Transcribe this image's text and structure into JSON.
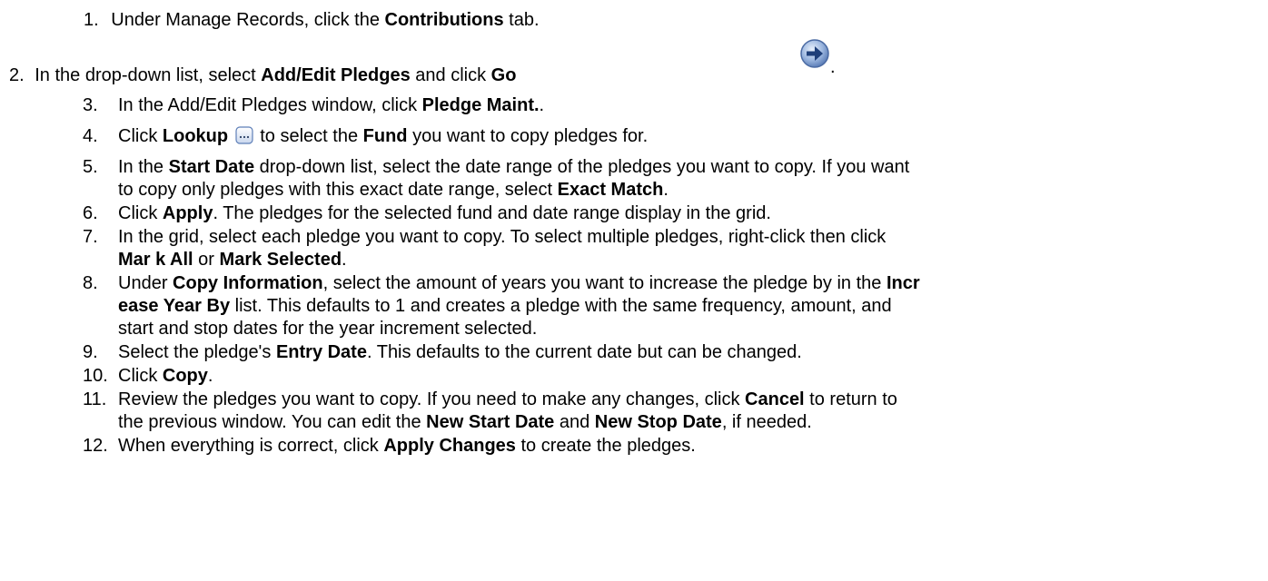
{
  "steps": [
    {
      "num": "1.",
      "parts": [
        "Under Manage Records, click the ",
        "Contributions",
        " tab."
      ]
    },
    {
      "num": "2.",
      "parts": [
        "In the drop-down list, select ",
        "Add/Edit Pledges",
        " and click ",
        "Go"
      ],
      "trailing": "."
    },
    {
      "num": "3.",
      "parts": [
        "In the Add/Edit Pledges window, click ",
        "Pledge Maint.",
        "."
      ]
    },
    {
      "num": "4.",
      "parts": [
        "Click ",
        "Lookup",
        " to select the ",
        "Fund",
        " you want to copy pledges for."
      ]
    },
    {
      "num": "5.",
      "lines": [
        [
          "In the ",
          "Start Date",
          " drop-down list, select the date range of the pledges you want to copy. If you want"
        ],
        [
          "to copy only pledges with this exact date range, select ",
          "Exact Match",
          "."
        ]
      ]
    },
    {
      "num": "6.",
      "parts": [
        "Click ",
        "Apply",
        ". The pledges for the selected fund and date range display in the grid."
      ]
    },
    {
      "num": "7.",
      "lines": [
        [
          "In the grid, select each pledge you want to copy. To select multiple pledges, right-click then click"
        ],
        [
          "",
          "Mar k All",
          " or ",
          "Mark Selected",
          "."
        ]
      ]
    },
    {
      "num": "8.",
      "lines": [
        [
          "Under ",
          "Copy Information",
          ", select the amount of years you want to increase the pledge by in the ",
          "Incr"
        ],
        [
          "",
          "ease Year By",
          " list. This defaults to 1 and creates a pledge with the same frequency, amount, and"
        ],
        [
          "start and stop dates for the year increment selected."
        ]
      ]
    },
    {
      "num": "9.",
      "parts": [
        "Select the pledge's ",
        "Entry Date",
        ". This defaults to the current date but can be changed."
      ]
    },
    {
      "num": "10.",
      "parts": [
        "Click ",
        "Copy",
        "."
      ]
    },
    {
      "num": "11.",
      "lines": [
        [
          "Review the pledges you want to copy. If you need to make any changes, click ",
          "Cancel",
          " to return to"
        ],
        [
          "the previous window. You can edit the ",
          "New Start Date",
          " and ",
          "New Stop Date",
          ", if needed."
        ]
      ]
    },
    {
      "num": "12.",
      "parts": [
        "When everything is correct, click ",
        "Apply Changes",
        " to create the pledges."
      ]
    }
  ],
  "icons": {
    "go": "go-arrow-icon",
    "lookup": "lookup-ellipsis-icon"
  }
}
